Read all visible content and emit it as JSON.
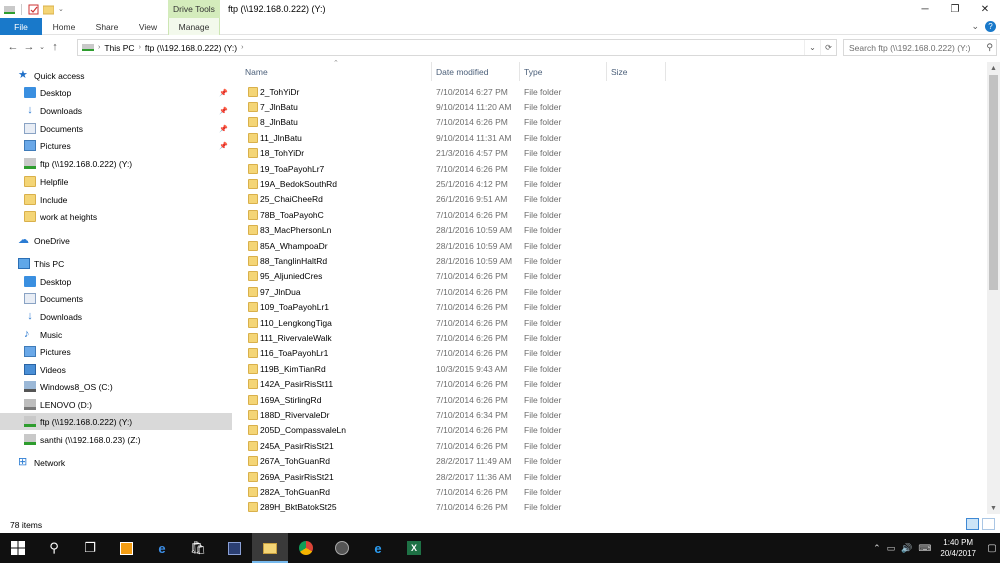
{
  "title_bar": {
    "drive_tools": "Drive Tools",
    "title": "ftp (\\\\192.168.0.222) (Y:)",
    "minimize": "─",
    "maximize": "❐",
    "close": "✕"
  },
  "ribbon": {
    "tabs": [
      "File",
      "Home",
      "Share",
      "View",
      "Manage"
    ],
    "expand": "⌄",
    "help": "?"
  },
  "address": {
    "back": "←",
    "forward": "→",
    "recent": "⌄",
    "up": "↑",
    "crumbs": [
      "This PC",
      "ftp (\\\\192.168.0.222) (Y:)"
    ],
    "search_placeholder": "Search ftp (\\\\192.168.0.222) (Y:)"
  },
  "nav": {
    "items": [
      {
        "label": "Quick access",
        "icon": "star-icon"
      },
      {
        "label": "Desktop",
        "icon": "desktop-icon",
        "pinned": true
      },
      {
        "label": "Downloads",
        "icon": "download-icon",
        "pinned": true
      },
      {
        "label": "Documents",
        "icon": "documents-icon",
        "pinned": true
      },
      {
        "label": "Pictures",
        "icon": "pictures-icon",
        "pinned": true
      },
      {
        "label": "ftp (\\\\192.168.0.222) (Y:)",
        "icon": "network-drive-icon"
      },
      {
        "label": "Helpfile",
        "icon": "folder-icon"
      },
      {
        "label": "Include",
        "icon": "folder-icon"
      },
      {
        "label": "work at heights",
        "icon": "folder-icon"
      },
      {
        "label": "OneDrive",
        "icon": "cloud-icon"
      },
      {
        "label": "This PC",
        "icon": "pc-icon"
      },
      {
        "label": "Desktop",
        "icon": "desktop-icon"
      },
      {
        "label": "Documents",
        "icon": "documents-icon"
      },
      {
        "label": "Downloads",
        "icon": "download-icon"
      },
      {
        "label": "Music",
        "icon": "music-icon"
      },
      {
        "label": "Pictures",
        "icon": "pictures-icon"
      },
      {
        "label": "Videos",
        "icon": "videos-icon"
      },
      {
        "label": "Windows8_OS (C:)",
        "icon": "windows-drive-icon"
      },
      {
        "label": "LENOVO (D:)",
        "icon": "disk-icon"
      },
      {
        "label": "ftp (\\\\192.168.0.222) (Y:)",
        "icon": "network-drive-icon",
        "selected": true
      },
      {
        "label": "santhi (\\\\192.168.0.23) (Z:)",
        "icon": "network-drive-icon"
      },
      {
        "label": "Network",
        "icon": "network-icon"
      }
    ]
  },
  "columns": [
    "Name",
    "Date modified",
    "Type",
    "Size"
  ],
  "files": [
    {
      "name": "2_TohYiDr",
      "date": "7/10/2014 6:27 PM",
      "type": "File folder"
    },
    {
      "name": "7_JlnBatu",
      "date": "9/10/2014 11:20 AM",
      "type": "File folder"
    },
    {
      "name": "8_JlnBatu",
      "date": "7/10/2014 6:26 PM",
      "type": "File folder"
    },
    {
      "name": "11_JlnBatu",
      "date": "9/10/2014 11:31 AM",
      "type": "File folder"
    },
    {
      "name": "18_TohYiDr",
      "date": "21/3/2016 4:57 PM",
      "type": "File folder"
    },
    {
      "name": "19_ToaPayohLr7",
      "date": "7/10/2014 6:26 PM",
      "type": "File folder"
    },
    {
      "name": "19A_BedokSouthRd",
      "date": "25/1/2016 4:12 PM",
      "type": "File folder"
    },
    {
      "name": "25_ChaiCheeRd",
      "date": "26/1/2016 9:51 AM",
      "type": "File folder"
    },
    {
      "name": "78B_ToaPayohC",
      "date": "7/10/2014 6:26 PM",
      "type": "File folder"
    },
    {
      "name": "83_MacPhersonLn",
      "date": "28/1/2016 10:59 AM",
      "type": "File folder"
    },
    {
      "name": "85A_WhampoaDr",
      "date": "28/1/2016 10:59 AM",
      "type": "File folder"
    },
    {
      "name": "88_TanglinHaltRd",
      "date": "28/1/2016 10:59 AM",
      "type": "File folder"
    },
    {
      "name": "95_AljuniedCres",
      "date": "7/10/2014 6:26 PM",
      "type": "File folder"
    },
    {
      "name": "97_JlnDua",
      "date": "7/10/2014 6:26 PM",
      "type": "File folder"
    },
    {
      "name": "109_ToaPayohLr1",
      "date": "7/10/2014 6:26 PM",
      "type": "File folder"
    },
    {
      "name": "110_LengkongTiga",
      "date": "7/10/2014 6:26 PM",
      "type": "File folder"
    },
    {
      "name": "111_RivervaleWalk",
      "date": "7/10/2014 6:26 PM",
      "type": "File folder"
    },
    {
      "name": "116_ToaPayohLr1",
      "date": "7/10/2014 6:26 PM",
      "type": "File folder"
    },
    {
      "name": "119B_KimTianRd",
      "date": "10/3/2015 9:43 AM",
      "type": "File folder"
    },
    {
      "name": "142A_PasirRisSt11",
      "date": "7/10/2014 6:26 PM",
      "type": "File folder"
    },
    {
      "name": "169A_StirlingRd",
      "date": "7/10/2014 6:26 PM",
      "type": "File folder"
    },
    {
      "name": "188D_RivervaleDr",
      "date": "7/10/2014 6:34 PM",
      "type": "File folder"
    },
    {
      "name": "205D_CompassvaleLn",
      "date": "7/10/2014 6:26 PM",
      "type": "File folder"
    },
    {
      "name": "245A_PasirRisSt21",
      "date": "7/10/2014 6:26 PM",
      "type": "File folder"
    },
    {
      "name": "267A_TohGuanRd",
      "date": "28/2/2017 11:49 AM",
      "type": "File folder"
    },
    {
      "name": "269A_PasirRisSt21",
      "date": "28/2/2017 11:36 AM",
      "type": "File folder"
    },
    {
      "name": "282A_TohGuanRd",
      "date": "7/10/2014 6:26 PM",
      "type": "File folder"
    },
    {
      "name": "289H_BktBatokSt25",
      "date": "7/10/2014 6:26 PM",
      "type": "File folder"
    }
  ],
  "status": {
    "item_count": "78 items"
  },
  "taskbar": {
    "apps": [
      "windows-start-icon",
      "search-icon",
      "task-view-icon",
      "media-app-icon",
      "edge-icon",
      "store-icon",
      "app-icon",
      "file-explorer-icon",
      "chrome-icon",
      "app-icon-2",
      "ie-icon",
      "excel-icon"
    ],
    "active_app": "file-explorer-icon",
    "time": "1:40 PM",
    "date": "20/4/2017"
  }
}
